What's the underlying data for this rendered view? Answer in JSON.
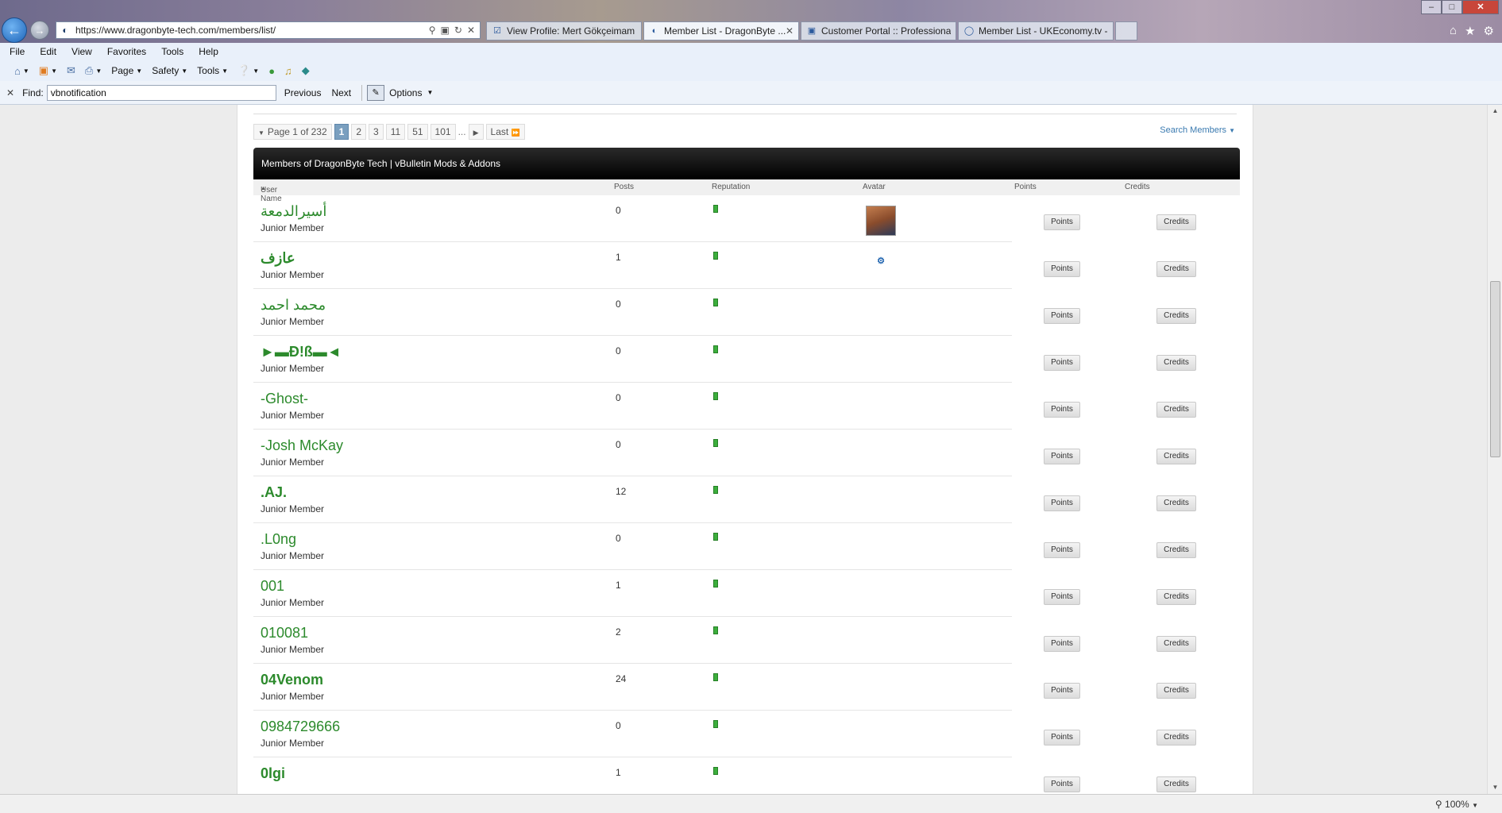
{
  "browser": {
    "address_url": "https://www.dragonbyte-tech.com/members/list/",
    "tabs": [
      {
        "label": "View Profile: Mert Gökçeimam ...",
        "active": false
      },
      {
        "label": "Member List - DragonByte ...",
        "active": true
      },
      {
        "label": "Customer Portal :: Professional...",
        "active": false
      },
      {
        "label": "Member List - UKEconomy.tv -...",
        "active": false
      }
    ],
    "menu": [
      "File",
      "Edit",
      "View",
      "Favorites",
      "Tools",
      "Help"
    ],
    "command_bar": {
      "page": "Page",
      "safety": "Safety",
      "tools": "Tools"
    },
    "find": {
      "label": "Find:",
      "value": "vbnotification",
      "previous": "Previous",
      "next": "Next",
      "options": "Options"
    },
    "zoom": "100%"
  },
  "pagination": {
    "label": "Page 1 of 232",
    "pages": [
      "1",
      "2",
      "3",
      "11",
      "51",
      "101"
    ],
    "ellipsis": "...",
    "last": "Last"
  },
  "search_members": "Search Members",
  "table": {
    "title": "Members of DragonByte Tech | vBulletin Mods & Addons",
    "columns": {
      "username": "User Name",
      "posts": "Posts",
      "reputation": "Reputation",
      "avatar": "Avatar",
      "points": "Points",
      "credits": "Credits"
    },
    "points_btn": "Points",
    "credits_btn": "Credits",
    "rows": [
      {
        "name": "أسيرالدمعة",
        "title": "Junior Member",
        "posts": "0",
        "avatar": "photo",
        "bold": false
      },
      {
        "name": "عازف",
        "title": "Junior Member",
        "posts": "1",
        "avatar": "logo",
        "bold": true
      },
      {
        "name": "محمد احمد",
        "title": "Junior Member",
        "posts": "0",
        "avatar": "",
        "bold": false
      },
      {
        "name": "►▬Ð!ß▬◄",
        "title": "Junior Member",
        "posts": "0",
        "avatar": "",
        "bold": true
      },
      {
        "name": "-Ghost-",
        "title": "Junior Member",
        "posts": "0",
        "avatar": "",
        "bold": false
      },
      {
        "name": "-Josh McKay",
        "title": "Junior Member",
        "posts": "0",
        "avatar": "",
        "bold": false
      },
      {
        "name": ".AJ.",
        "title": "Junior Member",
        "posts": "12",
        "avatar": "",
        "bold": true
      },
      {
        "name": ".L0ng",
        "title": "Junior Member",
        "posts": "0",
        "avatar": "",
        "bold": false
      },
      {
        "name": "001",
        "title": "Junior Member",
        "posts": "1",
        "avatar": "",
        "bold": false
      },
      {
        "name": "010081",
        "title": "Junior Member",
        "posts": "2",
        "avatar": "",
        "bold": false
      },
      {
        "name": "04Venom",
        "title": "Junior Member",
        "posts": "24",
        "avatar": "",
        "bold": true
      },
      {
        "name": "0984729666",
        "title": "Junior Member",
        "posts": "0",
        "avatar": "",
        "bold": false
      },
      {
        "name": "0lgi",
        "title": "",
        "posts": "1",
        "avatar": "",
        "bold": true
      }
    ]
  }
}
